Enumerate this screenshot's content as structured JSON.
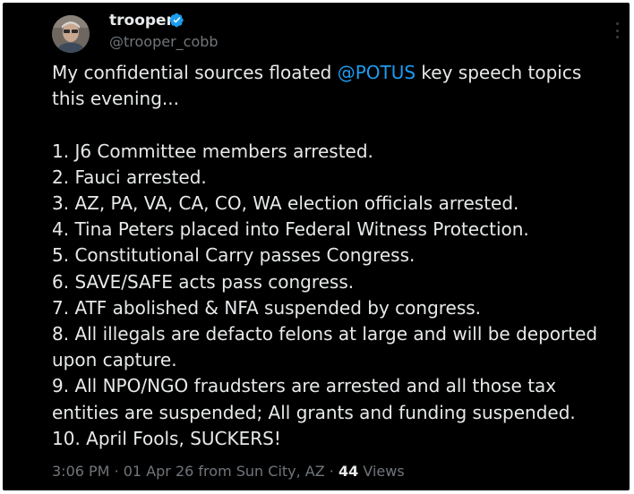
{
  "author": {
    "display_name": "trooper",
    "handle": "@trooper_cobb",
    "verified": true,
    "verified_color": "#1d9bf0"
  },
  "tweet": {
    "intro_before": "My confidential sources floated ",
    "mention": "@POTUS",
    "intro_after": " key speech topics",
    "intro_line2": "this evening...",
    "items": [
      "1. J6 Committee members arrested.",
      "2. Fauci arrested.",
      "3. AZ, PA, VA, CA, CO, WA election officials arrested.",
      "4. Tina Peters placed into Federal Witness Protection.",
      "5. Constitutional Carry passes Congress.",
      "6. SAVE/SAFE acts pass congress.",
      "7. ATF abolished & NFA suspended by congress.",
      "8. All illegals are defacto felons at large and will be deported",
      "upon capture.",
      "9. All NPO/NGO fraudsters are arrested and all those tax",
      "entities are suspended; All grants and funding suspended.",
      "10. April Fools, SUCKERS!"
    ]
  },
  "meta": {
    "time": "3:06 PM",
    "separator": "·",
    "date": "01 Apr 26",
    "source": "from Sun City, AZ",
    "views_count": "44",
    "views_label": "Views"
  },
  "icons": {
    "more": "more-vertical-icon",
    "verified": "verified-badge-icon"
  },
  "colors": {
    "background": "#000000",
    "text": "#e7e9ea",
    "secondary_text": "#71767b",
    "link": "#1d9bf0"
  }
}
